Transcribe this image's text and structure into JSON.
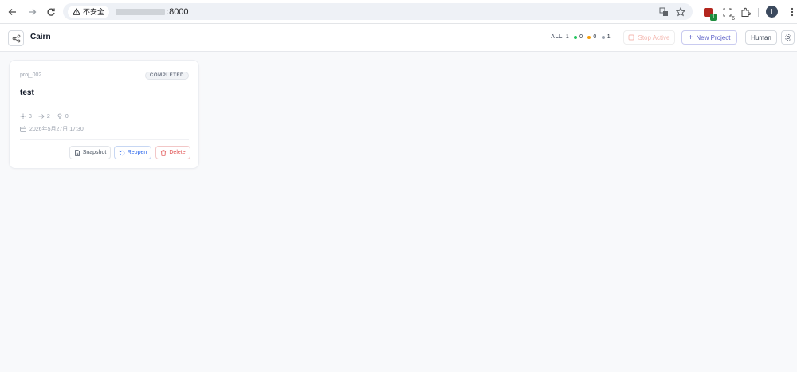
{
  "browser": {
    "insecure_label": "不安全",
    "url_tail": ":8000",
    "profile_initial": "I",
    "ext_badge": "1",
    "ext_count": "6"
  },
  "header": {
    "title": "Cairn",
    "counts": {
      "all_label": "ALL",
      "all": "1",
      "green": "0",
      "orange": "0",
      "gray": "1"
    },
    "stop_label": "Stop Active",
    "new_label": "New Project",
    "human_label": "Human"
  },
  "colors": {
    "green": "#22c55e",
    "orange": "#f59e0b",
    "gray": "#9ca3af",
    "accent": "#5b5fc7"
  },
  "projects": [
    {
      "id": "proj_002",
      "status": "COMPLETED",
      "name": "test",
      "stats": {
        "nodes": "3",
        "edges": "2",
        "notes": "0"
      },
      "date": "2026年5月27日 17:30",
      "snapshot_label": "Snapshot",
      "reopen_label": "Reopen",
      "delete_label": "Delete"
    }
  ]
}
